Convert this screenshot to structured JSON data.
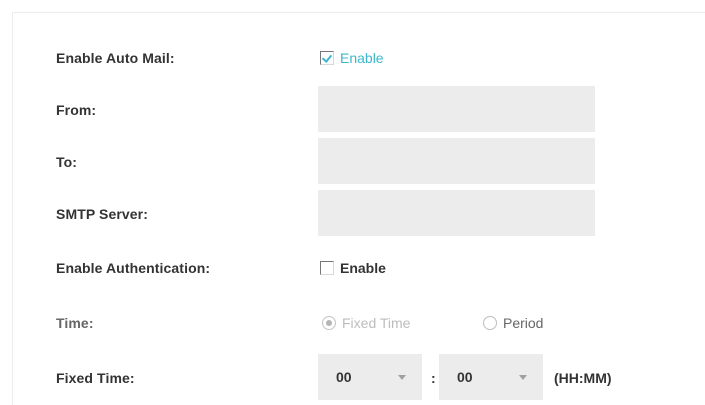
{
  "form": {
    "auto_mail": {
      "label": "Enable Auto Mail:",
      "checkbox_label": "Enable",
      "checked": true
    },
    "from": {
      "label": "From:",
      "value": ""
    },
    "to": {
      "label": "To:",
      "value": ""
    },
    "smtp_server": {
      "label": "SMTP Server:",
      "value": ""
    },
    "authentication": {
      "label": "Enable Authentication:",
      "checkbox_label": "Enable",
      "checked": false
    },
    "time": {
      "label": "Time:",
      "options": [
        {
          "label": "Fixed Time",
          "selected": true,
          "disabled": true
        },
        {
          "label": "Period",
          "selected": false,
          "disabled": false
        }
      ]
    },
    "fixed_time": {
      "label": "Fixed Time:",
      "hour": "00",
      "minute": "00",
      "separator": ":",
      "format_hint": "(HH:MM)"
    }
  },
  "colors": {
    "accent": "#3bb8c9",
    "field_background": "#ececec",
    "label_text": "#333333"
  }
}
